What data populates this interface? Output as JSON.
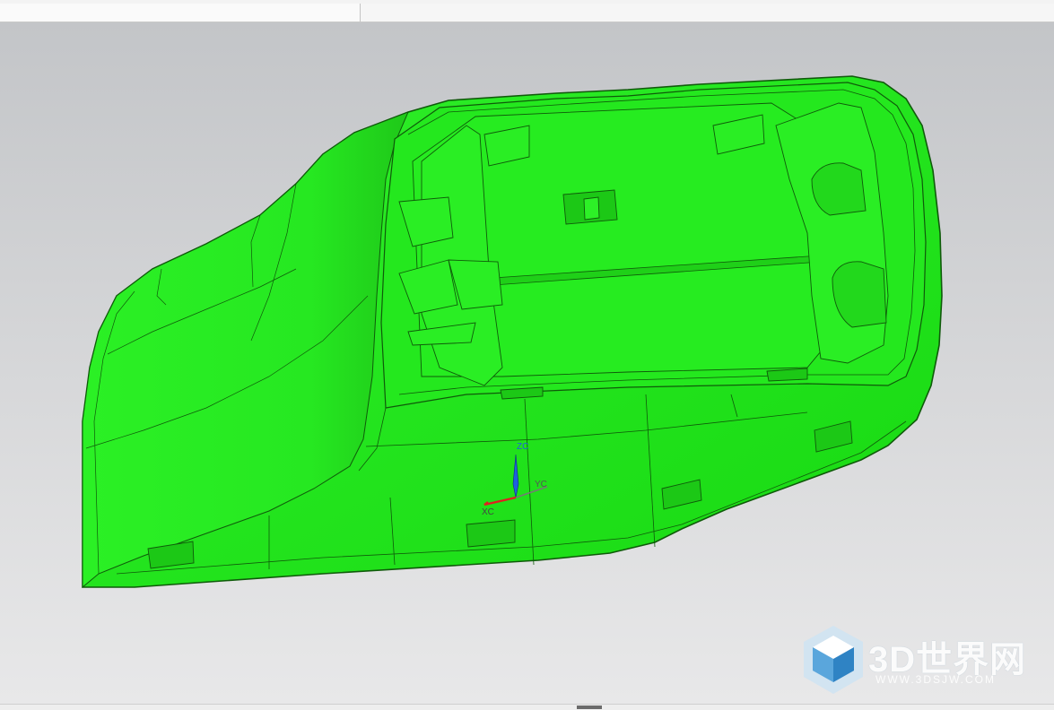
{
  "viewport": {
    "background_top": "#c3c5c8",
    "background_bottom": "#e8e8e9",
    "model_color": "#22ee1a",
    "model_edge_color": "#0a4a06"
  },
  "triad": {
    "z_label": "ZC",
    "y_label": "YC",
    "x_label": "XC",
    "z_color": "#1f5fe0",
    "y_color": "#777777",
    "x_color": "#e02020"
  },
  "watermark": {
    "title": "3D世界网",
    "url": "WWW.3DSJW.COM",
    "logo_icon": "cube-icon"
  }
}
